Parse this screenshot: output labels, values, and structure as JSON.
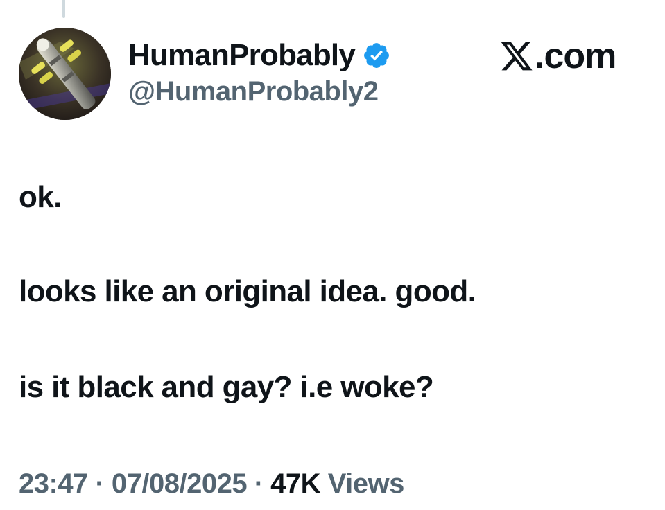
{
  "author": {
    "display_name": "HumanProbably",
    "handle": "@HumanProbably2",
    "verified_icon": "verified-badge-icon",
    "verified_color": "#1d9bf0"
  },
  "brand": {
    "icon": "x-logo-icon",
    "text": ".com"
  },
  "tweet": {
    "lines": [
      "ok.",
      "looks like an original idea. good.",
      "is it black and gay? i.e woke?"
    ]
  },
  "meta": {
    "time": "23:47",
    "separator": "·",
    "date": "07/08/2025",
    "views_count": "47K",
    "views_label": "Views"
  },
  "colors": {
    "text_primary": "#0f1419",
    "text_secondary": "#536471",
    "thread_line": "#cfd9de"
  }
}
